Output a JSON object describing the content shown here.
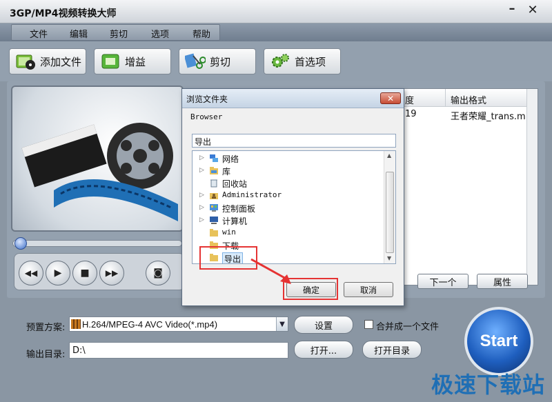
{
  "window": {
    "title": "3GP/MP4视频转换大师",
    "min_glyph": "–",
    "close_glyph": "✕"
  },
  "menu": {
    "items": [
      "文件",
      "编辑",
      "剪切",
      "选项",
      "帮助"
    ]
  },
  "toolbar": {
    "buttons": [
      {
        "label": "添加文件",
        "icon": "add-file-icon"
      },
      {
        "label": "增益",
        "icon": "gain-icon"
      },
      {
        "label": "剪切",
        "icon": "scissors-icon"
      },
      {
        "label": "首选项",
        "icon": "gears-icon"
      }
    ]
  },
  "filelist": {
    "columns": [
      "度",
      "输出格式"
    ],
    "row": {
      "duration": "19",
      "output": "王者荣耀_trans.m..."
    }
  },
  "list_buttons": {
    "next": "下一个",
    "props": "属性"
  },
  "bottom": {
    "preset_label": "预置方案:",
    "preset_value": "H.264/MPEG-4 AVC Video(*.mp4)",
    "settings_label": "设置",
    "merge_label": "合并成一个文件",
    "output_label": "输出目录:",
    "output_value": "D:\\",
    "open_label": "打开...",
    "open_dir_label": "打开目录",
    "start_label": "Start"
  },
  "dialog": {
    "title": "浏览文件夹",
    "close_glyph": "✕",
    "browse_text": "Browser",
    "path_value": "导出",
    "tree_items": [
      {
        "label": "网络",
        "icon": "network-icon",
        "expandable": true
      },
      {
        "label": "库",
        "icon": "library-icon",
        "expandable": true
      },
      {
        "label": "回收站",
        "icon": "recycle-bin-icon",
        "expandable": false
      },
      {
        "label": "Administrator",
        "icon": "user-folder-icon",
        "expandable": true
      },
      {
        "label": "控制面板",
        "icon": "control-panel-icon",
        "expandable": true
      },
      {
        "label": "计算机",
        "icon": "computer-icon",
        "expandable": true
      },
      {
        "label": "win",
        "icon": "folder-icon",
        "expandable": false
      },
      {
        "label": "下载",
        "icon": "folder-icon",
        "expandable": false
      },
      {
        "label": "导出",
        "icon": "folder-icon",
        "expandable": false,
        "selected": true
      }
    ],
    "ok_label": "确定",
    "cancel_label": "取消"
  },
  "watermark": "极速下载站",
  "colors": {
    "highlight": "#e53333",
    "start_blue": "#1f5fbf",
    "watermark": "#1f6fb5"
  }
}
